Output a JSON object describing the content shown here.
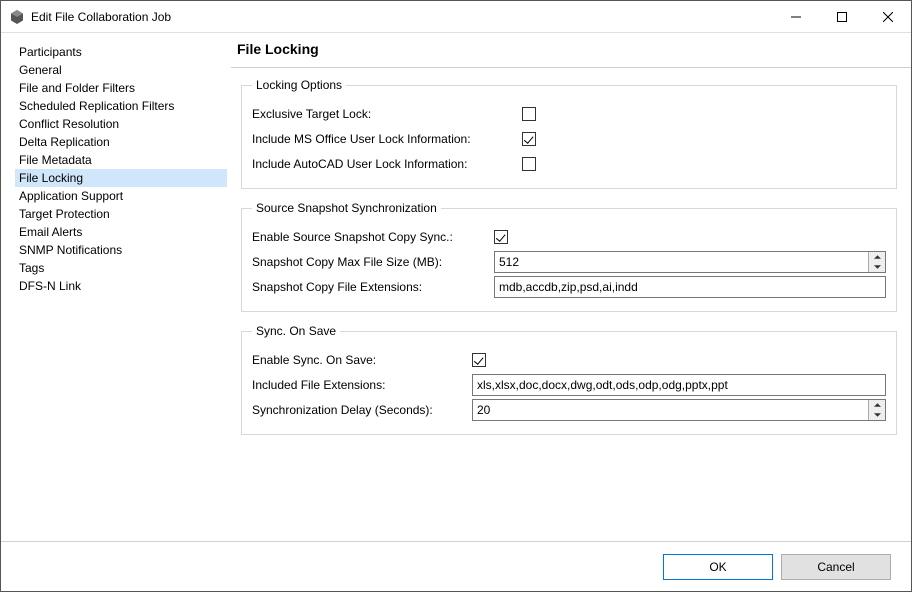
{
  "window": {
    "title": "Edit File Collaboration Job"
  },
  "sidebar": {
    "items": [
      {
        "label": "Participants"
      },
      {
        "label": "General"
      },
      {
        "label": "File and Folder Filters"
      },
      {
        "label": "Scheduled Replication Filters"
      },
      {
        "label": "Conflict Resolution"
      },
      {
        "label": "Delta Replication"
      },
      {
        "label": "File Metadata"
      },
      {
        "label": "File Locking"
      },
      {
        "label": "Application Support"
      },
      {
        "label": "Target Protection"
      },
      {
        "label": "Email Alerts"
      },
      {
        "label": "SNMP Notifications"
      },
      {
        "label": "Tags"
      },
      {
        "label": "DFS-N Link"
      }
    ],
    "selected_index": 7
  },
  "page": {
    "title": "File Locking",
    "locking_options": {
      "legend": "Locking Options",
      "exclusive_target_lock_label": "Exclusive Target Lock:",
      "exclusive_target_lock_checked": false,
      "ms_office_label": "Include MS Office User Lock Information:",
      "ms_office_checked": true,
      "autocad_label": "Include AutoCAD User Lock Information:",
      "autocad_checked": false
    },
    "source_snapshot": {
      "legend": "Source Snapshot Synchronization",
      "enable_label": "Enable Source Snapshot Copy Sync.:",
      "enable_checked": true,
      "max_size_label": "Snapshot Copy Max File Size (MB):",
      "max_size_value": "512",
      "ext_label": "Snapshot Copy File Extensions:",
      "ext_value": "mdb,accdb,zip,psd,ai,indd"
    },
    "sync_on_save": {
      "legend": "Sync. On Save",
      "enable_label": "Enable Sync. On Save:",
      "enable_checked": true,
      "included_ext_label": "Included File Extensions:",
      "included_ext_value": "xls,xlsx,doc,docx,dwg,odt,ods,odp,odg,pptx,ppt",
      "delay_label": "Synchronization Delay (Seconds):",
      "delay_value": "20"
    }
  },
  "buttons": {
    "ok": "OK",
    "cancel": "Cancel"
  }
}
